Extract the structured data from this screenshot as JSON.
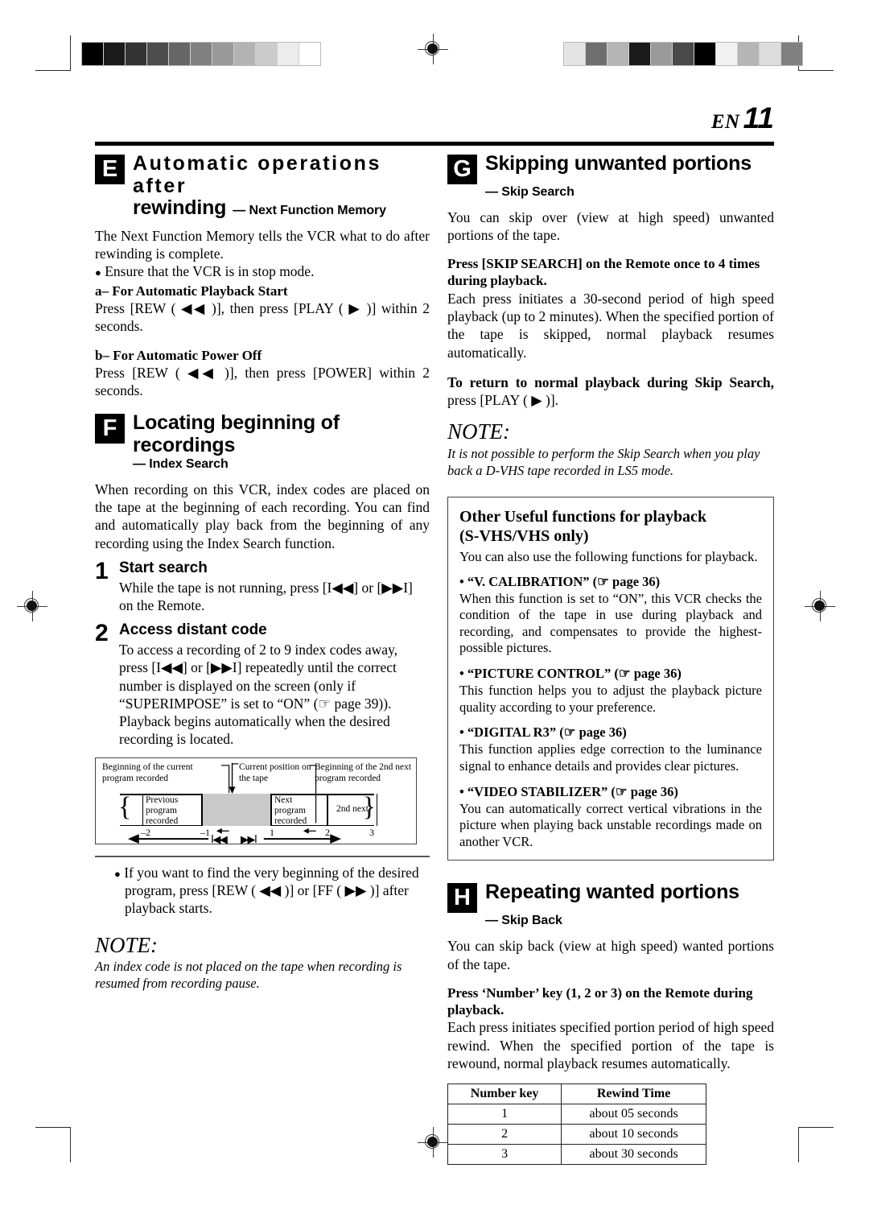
{
  "page": {
    "locale_label": "EN",
    "page_number": "11"
  },
  "printmarks": {
    "gray_bar_left": [
      "#000000",
      "#1b1b1b",
      "#333333",
      "#4d4d4d",
      "#666666",
      "#808080",
      "#999999",
      "#b3b3b3",
      "#cccccc",
      "#ececec",
      "#ffffff"
    ],
    "gray_bar_right": [
      "#e4e4e4",
      "#6e6e6e",
      "#b5b5b5",
      "#1a1a1a",
      "#9a9a9a",
      "#494949",
      "#000000",
      "#f2f2f2",
      "#b5b5b5",
      "#dcdcdc",
      "#808080"
    ],
    "registration_mark": "registration-target"
  },
  "sections": {
    "E": {
      "badge": "E",
      "title": "Automatic operations after rewinding",
      "title_line1": "Automatic  operations  after",
      "title_line2": "rewinding",
      "subtitle": "— Next Function Memory",
      "intro": "The Next Function Memory tells the VCR what to do after rewinding is complete.",
      "bullet": "Ensure that the VCR is in stop mode.",
      "items": [
        {
          "label": "a– For Automatic Playback Start",
          "text": "Press [REW ( ◀◀ )], then press [PLAY ( ▶ )] within 2 seconds."
        },
        {
          "label": "b– For Automatic Power Off",
          "text": "Press [REW ( ◀◀ )], then press [POWER] within 2 seconds."
        }
      ]
    },
    "F": {
      "badge": "F",
      "title": "Locating beginning of recordings",
      "subtitle": "— Index Search",
      "intro": "When recording on this VCR, index codes are placed on the tape at the beginning of each recording. You can find and automatically play back from the beginning of any recording using the Index Search function.",
      "steps": [
        {
          "num": "1",
          "head": "Start search",
          "text": "While the tape is not running, press [I◀◀] or [▶▶I] on the Remote."
        },
        {
          "num": "2",
          "head": "Access distant code",
          "text": "To access a recording of 2 to 9 index codes away, press [I◀◀] or [▶▶I] repeatedly until the correct number is displayed on the screen (only if “SUPERIMPOSE” is set to “ON” (☞ page 39)). Playback begins automatically when the desired recording is located."
        }
      ],
      "diagram": {
        "label_left": "Beginning of the current program recorded",
        "label_mid": "Current position on the tape",
        "label_right": "Beginning of the 2nd next program recorded",
        "segments": [
          "Previous program recorded",
          "Next program recorded",
          "2nd next"
        ],
        "ticks": [
          "–2",
          "–1",
          "1",
          "2",
          "3"
        ],
        "rew_symbol": "I◀◀",
        "ff_symbol": "▶▶I"
      },
      "bullet_after": "If you want to find the very beginning of the desired program, press [REW ( ◀◀ )] or [FF ( ▶▶ )] after playback starts.",
      "note_head": "NOTE:",
      "note_body": "An index code is not placed on the tape when recording is resumed from recording pause."
    },
    "G": {
      "badge": "G",
      "title": "Skipping unwanted portions",
      "subtitle": "— Skip Search",
      "intro": "You can skip over (view at high speed) unwanted portions of the tape.",
      "instruction_bold": "Press [SKIP SEARCH] on the Remote once to 4 times during playback.",
      "instruction_body": "Each press initiates a 30-second period of high speed playback (up to 2 minutes). When the specified portion of the tape is skipped, normal playback resumes automatically.",
      "return_bold": "To return to normal playback during Skip Search,",
      "return_rest": " press [PLAY ( ▶ )].",
      "note_head": "NOTE:",
      "note_body": "It is not possible to perform the Skip Search when you play back a D-VHS tape recorded in LS5 mode."
    },
    "other_functions_box": {
      "title_line1": "Other Useful functions for playback",
      "title_line2": "(S-VHS/VHS only)",
      "lead": "You can also use the following functions for playback.",
      "functions": [
        {
          "name": "• “V. CALIBRATION” (☞ page 36)",
          "body": "When this function is set to “ON”, this VCR checks the condition of the tape in use during playback and recording, and compensates to provide the highest-possible pictures."
        },
        {
          "name": "• “PICTURE CONTROL” (☞ page 36)",
          "body": "This function helps you to adjust the playback picture quality according to your preference."
        },
        {
          "name": "• “DIGITAL R3” (☞ page 36)",
          "body": "This function applies edge correction to the luminance signal to enhance details and provides clear pictures."
        },
        {
          "name": "• “VIDEO STABILIZER” (☞ page 36)",
          "body": "You can automatically correct vertical vibrations in the picture when playing back unstable recordings made on another VCR."
        }
      ]
    },
    "H": {
      "badge": "H",
      "title": "Repeating wanted portions",
      "subtitle": "— Skip Back",
      "intro": "You can skip back (view at high speed) wanted portions of the tape.",
      "instruction_bold": "Press ‘Number’ key (1, 2 or 3) on the Remote during playback.",
      "instruction_body": "Each press initiates specified portion period of high speed rewind. When the specified portion of the tape is rewound, normal playback resumes automatically.",
      "table": {
        "headers": [
          "Number key",
          "Rewind Time"
        ],
        "rows": [
          [
            "1",
            "about 05 seconds"
          ],
          [
            "2",
            "about 10 seconds"
          ],
          [
            "3",
            "about 30 seconds"
          ]
        ]
      }
    }
  }
}
